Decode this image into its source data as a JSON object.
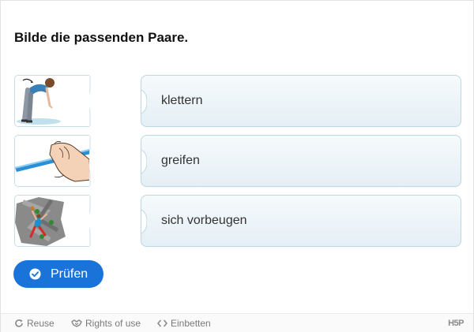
{
  "task": {
    "title": "Bilde die passenden Paare."
  },
  "pairs": [
    {
      "image_icon": "person-bending-forward-icon",
      "label": "klettern"
    },
    {
      "image_icon": "hand-grabbing-pole-icon",
      "label": "greifen"
    },
    {
      "image_icon": "climber-on-wall-icon",
      "label": "sich vorbeugen"
    }
  ],
  "check_button": {
    "label": "Prüfen",
    "icon": "check-circle-icon"
  },
  "footer": {
    "reuse": "Reuse",
    "rights": "Rights of use",
    "embed": "Einbetten",
    "brand": "H5P"
  },
  "colors": {
    "accent": "#1a73d9",
    "card_border": "#bcd8e6",
    "card_gradient_top": "#f6fafc",
    "card_gradient_bottom": "#e4eff5",
    "footer_text": "#7a7a7a"
  }
}
